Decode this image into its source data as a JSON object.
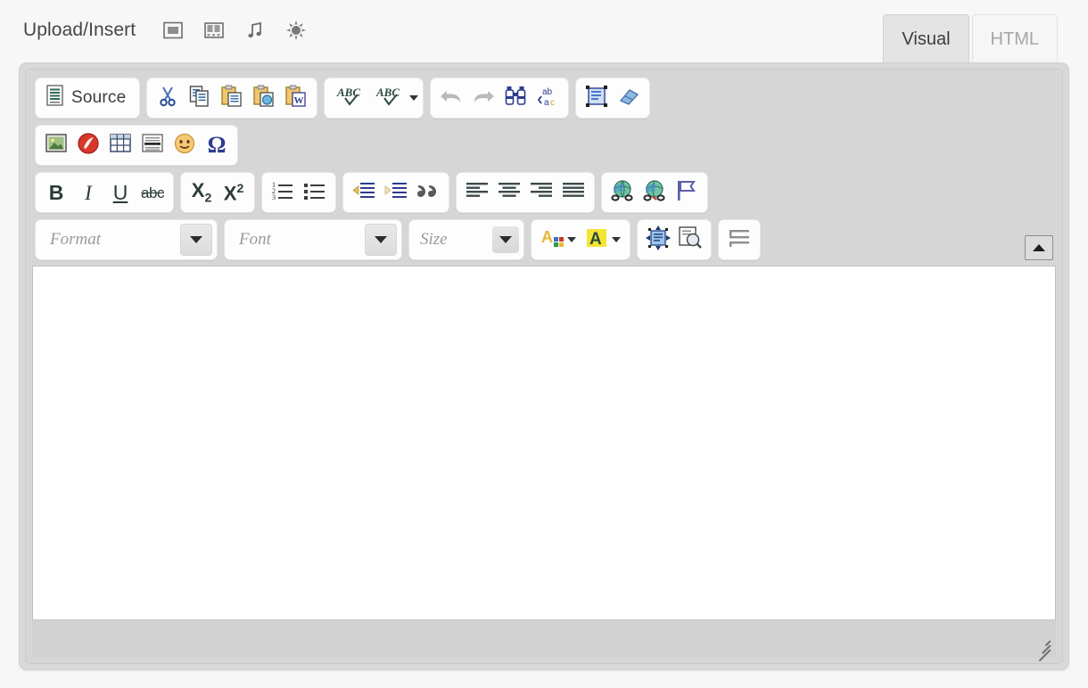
{
  "header": {
    "upload_label": "Upload/Insert",
    "media_buttons": [
      {
        "name": "add-image-icon",
        "title": "Add an Image"
      },
      {
        "name": "add-video-icon",
        "title": "Add Video"
      },
      {
        "name": "add-audio-icon",
        "title": "Add Audio"
      },
      {
        "name": "add-media-icon",
        "title": "Add Media"
      }
    ],
    "tabs": [
      {
        "label": "Visual",
        "name": "tab-visual",
        "active": true
      },
      {
        "label": "HTML",
        "name": "tab-html",
        "active": false
      }
    ]
  },
  "toolbar": {
    "source_label": "Source",
    "rows": [
      {
        "groups": [
          {
            "buttons": [
              {
                "icon": "source-icon",
                "label": "Source"
              }
            ]
          },
          {
            "buttons": [
              {
                "icon": "cut-icon"
              },
              {
                "icon": "copy-icon"
              },
              {
                "icon": "paste-icon"
              },
              {
                "icon": "paste-text-icon"
              },
              {
                "icon": "paste-from-word-icon"
              }
            ]
          },
          {
            "buttons": [
              {
                "icon": "spellcheck-icon"
              },
              {
                "icon": "spellcheck-options-icon",
                "caret": true
              }
            ]
          },
          {
            "buttons": [
              {
                "icon": "undo-icon"
              },
              {
                "icon": "redo-icon"
              },
              {
                "icon": "find-icon"
              },
              {
                "icon": "replace-icon"
              }
            ]
          },
          {
            "buttons": [
              {
                "icon": "select-all-icon"
              },
              {
                "icon": "remove-format-icon"
              }
            ]
          }
        ]
      },
      {
        "groups": [
          {
            "buttons": [
              {
                "icon": "image-icon"
              },
              {
                "icon": "flash-icon"
              },
              {
                "icon": "table-icon"
              },
              {
                "icon": "horizontal-rule-icon"
              },
              {
                "icon": "smiley-icon"
              },
              {
                "icon": "special-character-icon"
              }
            ]
          }
        ]
      },
      {
        "groups": [
          {
            "buttons": [
              {
                "icon": "bold-icon"
              },
              {
                "icon": "italic-icon"
              },
              {
                "icon": "underline-icon"
              },
              {
                "icon": "strikethrough-icon"
              }
            ]
          },
          {
            "buttons": [
              {
                "icon": "subscript-icon"
              },
              {
                "icon": "superscript-icon"
              }
            ]
          },
          {
            "buttons": [
              {
                "icon": "numbered-list-icon"
              },
              {
                "icon": "bulleted-list-icon"
              }
            ]
          },
          {
            "buttons": [
              {
                "icon": "outdent-icon"
              },
              {
                "icon": "indent-icon"
              },
              {
                "icon": "blockquote-icon"
              }
            ]
          },
          {
            "buttons": [
              {
                "icon": "align-left-icon"
              },
              {
                "icon": "align-center-icon"
              },
              {
                "icon": "align-right-icon"
              },
              {
                "icon": "align-justify-icon"
              }
            ]
          },
          {
            "buttons": [
              {
                "icon": "link-icon"
              },
              {
                "icon": "unlink-icon"
              },
              {
                "icon": "anchor-icon"
              }
            ]
          }
        ]
      },
      {
        "selects": [
          {
            "label": "Format",
            "name": "format-select"
          },
          {
            "label": "Font",
            "name": "font-select"
          },
          {
            "label": "Size",
            "name": "size-select"
          }
        ],
        "groups": [
          {
            "buttons": [
              {
                "icon": "text-color-icon",
                "caret": true
              },
              {
                "icon": "background-color-icon",
                "caret": true
              }
            ]
          },
          {
            "buttons": [
              {
                "icon": "maximize-icon"
              },
              {
                "icon": "show-blocks-icon"
              }
            ]
          },
          {
            "buttons": [
              {
                "icon": "page-break-icon"
              }
            ]
          }
        ]
      }
    ],
    "collapse_label": "Collapse Toolbar"
  },
  "editor": {
    "content": "",
    "resize_handle": "resize-grip"
  },
  "colors": {
    "toolbar_bg": "#d6d6d6",
    "group_bg": "#fdfdfd",
    "active_tab_bg": "#e4e4e4",
    "content_bg": "#ffffff",
    "statusbar_bg": "#d2d2d2"
  }
}
